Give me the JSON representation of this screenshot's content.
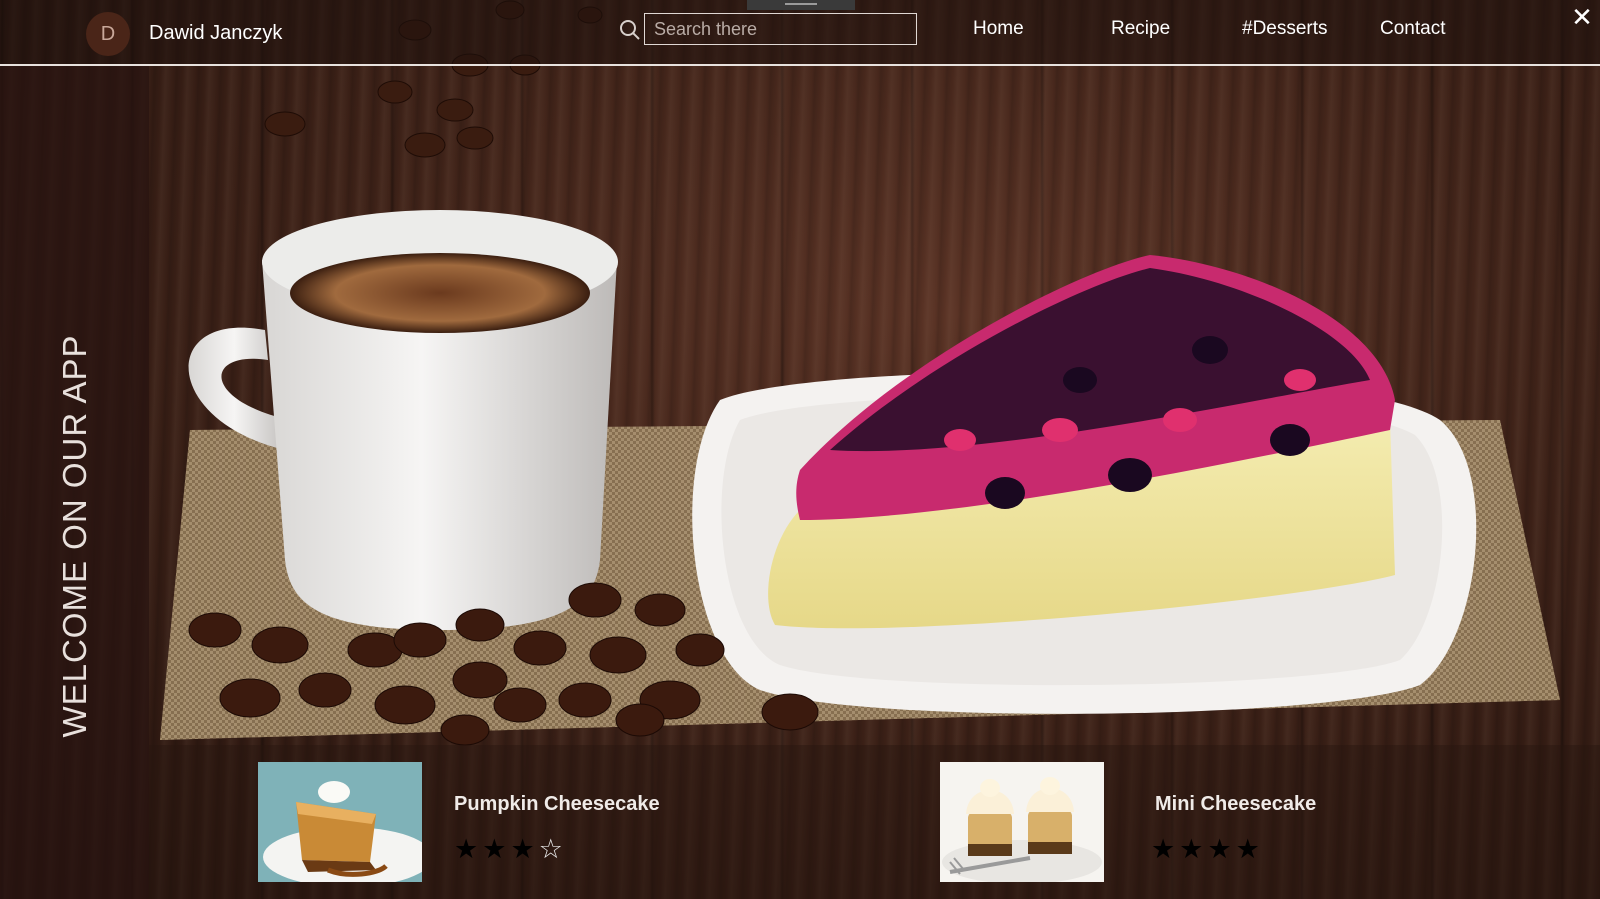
{
  "header": {
    "avatar_initial": "D",
    "user_name": "Dawid Janczyk",
    "search_placeholder": "Search there",
    "nav": [
      {
        "label": "Home"
      },
      {
        "label": "Recipe"
      },
      {
        "label": "#Desserts"
      },
      {
        "label": "Contact"
      }
    ],
    "close_icon": "close-icon"
  },
  "sidebar": {
    "welcome_text": "WELCOME ON OUR APP"
  },
  "cards": [
    {
      "title": "Pumpkin Cheesecake",
      "rating": 3,
      "max_rating": 4
    },
    {
      "title": "Mini Cheesecake",
      "rating": 4,
      "max_rating": 4
    }
  ],
  "colors": {
    "accent": "#4a2518",
    "text": "#ffffff"
  }
}
